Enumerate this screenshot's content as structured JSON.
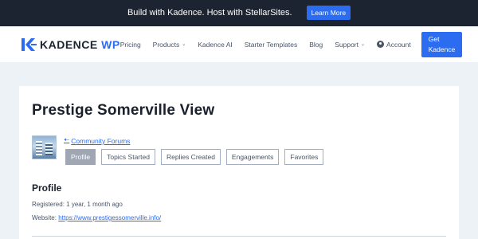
{
  "promo": {
    "text": "Build with Kadence. Host with StellarSites.",
    "button": "Learn More"
  },
  "header": {
    "logo_main": "KADENCE",
    "logo_accent": "WP",
    "nav": [
      {
        "label": "Pricing"
      },
      {
        "label": "Products",
        "dropdown": true
      },
      {
        "label": "Kadence AI"
      },
      {
        "label": "Starter Templates"
      },
      {
        "label": "Blog"
      },
      {
        "label": "Support",
        "dropdown": true
      }
    ],
    "account": "Account",
    "cta": "Get Kadence"
  },
  "profile": {
    "title": "Prestige Somerville View",
    "back_link": "Community Forums",
    "tabs": [
      {
        "label": "Profile",
        "active": true
      },
      {
        "label": "Topics Started"
      },
      {
        "label": "Replies Created"
      },
      {
        "label": "Engagements"
      },
      {
        "label": "Favorites"
      }
    ],
    "section_title": "Profile",
    "registered_label": "Registered:",
    "registered_value": "1 year, 1 month ago",
    "website_label": "Website:",
    "website_value": "https://www.prestigessomerville.info/"
  },
  "colors": {
    "accent": "#2b6cf0",
    "dark": "#1c2431",
    "background": "#edf2f7"
  },
  "icons": {
    "logo": "kadence-k-icon",
    "dropdown": "chevron-down-icon",
    "account": "user-circle-icon",
    "back": "arrow-left-icon"
  }
}
